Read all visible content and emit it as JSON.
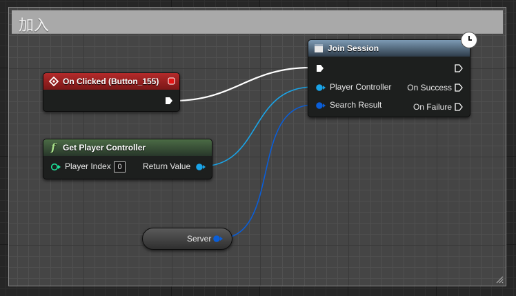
{
  "comment": {
    "title": "加入"
  },
  "nodes": {
    "on_clicked": {
      "title": "On Clicked (Button_155)"
    },
    "get_player_controller": {
      "title": "Get Player Controller",
      "input_label": "Player Index",
      "input_value": "0",
      "output_label": "Return Value"
    },
    "join_session": {
      "title": "Join Session",
      "inputs": [
        "Player Controller",
        "Search Result"
      ],
      "outputs": [
        "On Success",
        "On Failure"
      ]
    },
    "server_var": {
      "label": "Server"
    }
  },
  "colors": {
    "exec_wire": "#ffffff",
    "object_pin": "#1aa4e8",
    "struct_pin": "#0a5ed8",
    "event_header": "#b32a2a",
    "function_header": "#4b6b45",
    "call_header": "#5b7893"
  },
  "icons": {
    "event": "event-diamond-icon",
    "function": "function-f-icon",
    "call": "function-call-icon",
    "latent": "clock-icon"
  }
}
